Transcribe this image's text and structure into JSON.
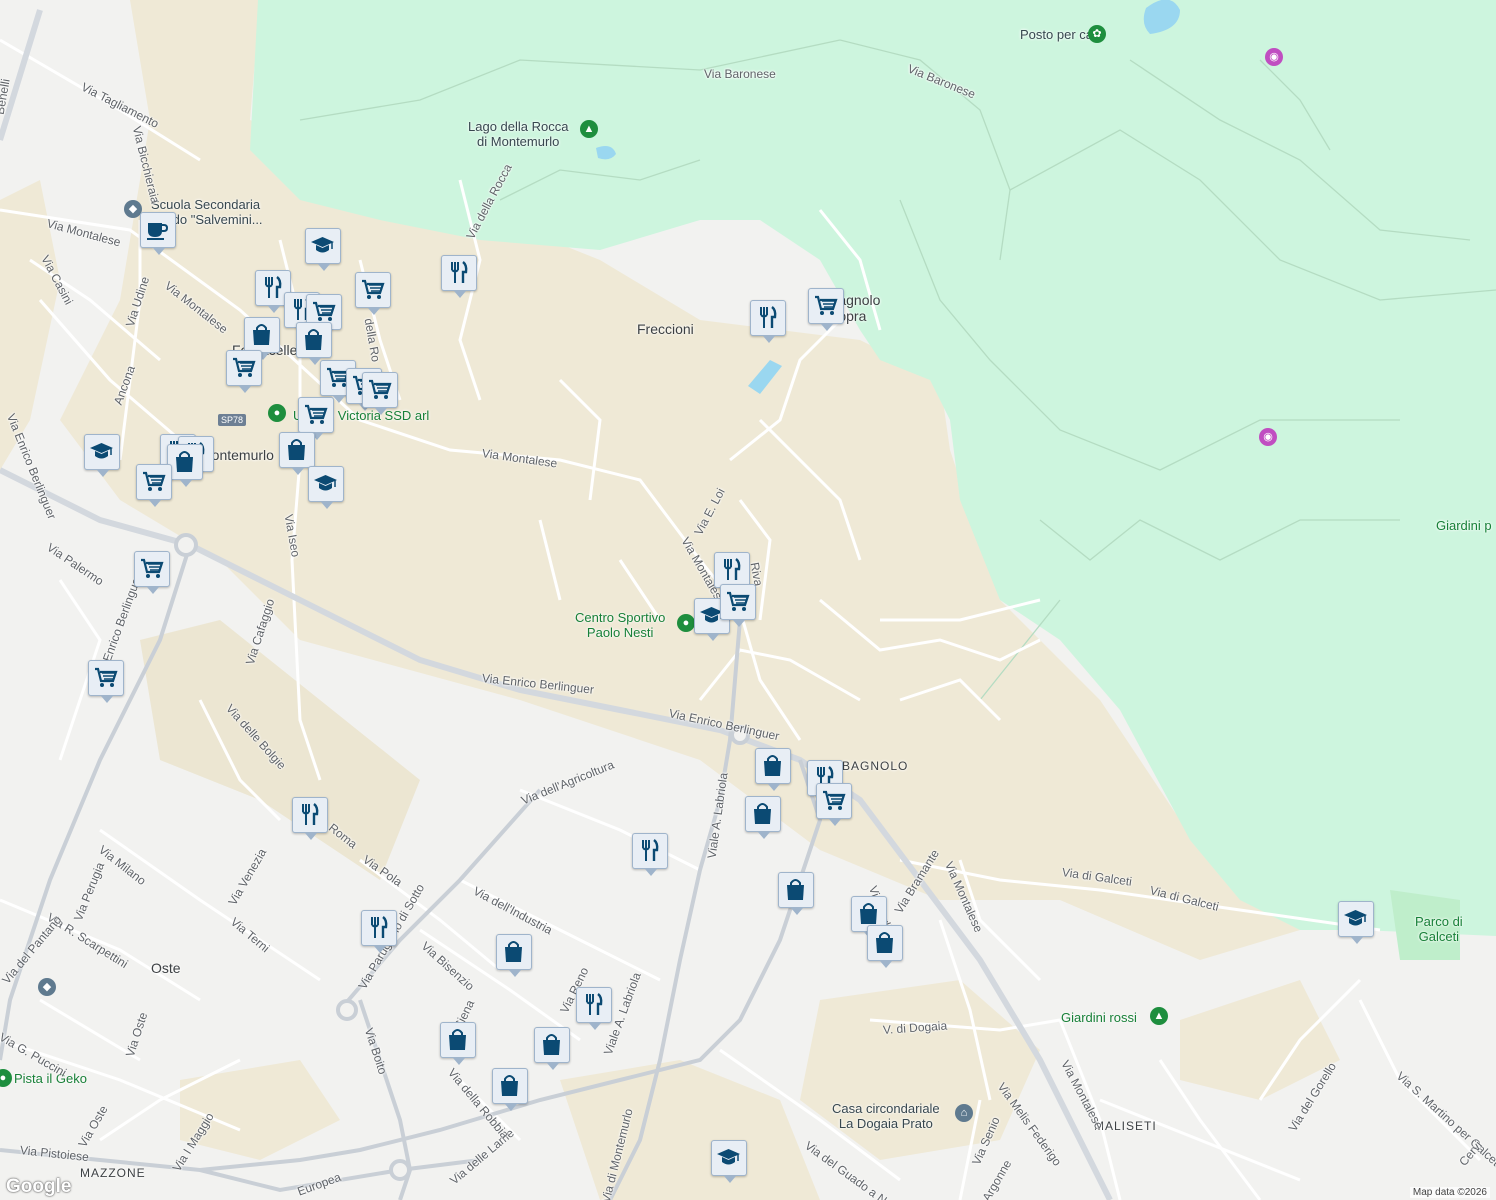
{
  "map": {
    "copyright": "Map data ©2026",
    "logo": "Google",
    "colors": {
      "background": "#f2f2f0",
      "park": "#cdf5de",
      "sand": "#efe9d6",
      "road": "#ffffff",
      "major_road": "#c9cfd6",
      "water": "#9ad7f0",
      "marker_bg": "#e8eef5",
      "marker_icon": "#0b4a73"
    },
    "places": {
      "montemurlo": "Montemurlo",
      "freccioni": "Freccioni",
      "bagnolo_sopra": "Bagnolo\nSopra",
      "oste": "Oste",
      "fornacelle": "Fornacelle"
    },
    "areas": {
      "bagnolo": "BAGNOLO",
      "maliseti": "MALISETI",
      "mazzone": "MAZZONE"
    },
    "pois": {
      "posto_per_cani": "Posto per cani",
      "lago": "Lago della Rocca\ndi Montemurlo",
      "scuola": "Scuola Secondaria\nGrado \"Salvemini...",
      "victoria": "Unione Victoria SSD arl",
      "centro_sportivo": "Centro Sportivo\nPaolo Nesti",
      "giardini_rossi": "Giardini rossi",
      "casa_circondariale": "Casa circondariale\nLa Dogaia Prato",
      "parco_galceti": "Parco di\nGalceti",
      "pista_geko": "Pista il Geko",
      "giardini_p": "Giardini p"
    },
    "roads": {
      "via_baronese_1": "Via Baronese",
      "via_baronese_2": "Via Baronese",
      "via_della_rocca": "Via della Rocca",
      "via_montalese_1": "Via Montalese",
      "via_montalese_2": "Via Montalese",
      "via_montalese_3": "Via Montalese",
      "via_montalese_4": "Via Montalese",
      "via_montalese_5": "Via Montalese",
      "via_montalese_6": "Via Montalese",
      "via_tagliamento": "Via Tagliamento",
      "via_bicchieraia": "Via Bicchieraia",
      "via_casini": "Via Casini",
      "via_udine": "Via Udine",
      "via_ancona": "Ancona",
      "via_berlinguer_1": "Via Enrico Berlinguer",
      "via_berlinguer_2": "Via Enrico Berlinguer",
      "via_berlinguer_3": "Via Enrico Berlinguer",
      "via_berlinguer_4": "Via Enrico Berlinguer",
      "via_palermo": "Via Palermo",
      "via_iseo": "Via Iseo",
      "via_cafaggio": "Via Cafaggio",
      "via_delle_bolgie": "Via delle Bolgie",
      "via_e_loi": "Via E. Loi",
      "via_dellagricoltura": "Via dell'Agricoltura",
      "viale_labriola": "Viale A. Labriola",
      "viale_labriola_2": "Viale A. Labriola",
      "via_dellindustria": "Via dell'Industria",
      "via_bisenzio": "Via Bisenzio",
      "via_parugiano": "Via Parugiano di Sotto",
      "via_pola": "Via Pola",
      "via_roma": "Roma",
      "via_milano": "Via Milano",
      "via_perugia": "Via Perugia",
      "via_venezia": "Via Venezia",
      "via_terni": "Via Terni",
      "via_scarpettini": "Via R. Scarpettini",
      "via_del_pantano": "Via del Pantano",
      "via_puccini": "Via G. Puccini",
      "via_oste_1": "Via Oste",
      "via_oste_2": "Via Oste",
      "via_boito": "Via Boito",
      "via_pistoiese": "Via Pistoiese",
      "via_i_maggio": "Via I Maggio",
      "via_europea": "Europea",
      "via_delle_lame": "Via delle Lame",
      "via_della_robbia": "Via della Robbia",
      "via_siena": "Siena",
      "via_reno": "Via Reno",
      "via_di_montemurlo": "Via di Montemurlo",
      "via_di_galceti_1": "Via di Galceti",
      "via_di_galceti_2": "Via di Galceti",
      "via_bramante": "Via Bramante",
      "v_di_dogaia": "V. di Dogaia",
      "via_melis_federigo": "Via Melis Federigo",
      "via_senio": "Via Senio",
      "via_argonne": "Argonne",
      "via_del_guado": "Via del Guado a Narnali",
      "via_del_gorello": "Via del Gorello",
      "via_s_martino": "Via S. Martino per Galceti",
      "via_cervi": "Cervi",
      "via_benelli": "Benelli",
      "via_riva": "Riva",
      "via_della_ro": "della Ro",
      "via_berlinguer_v": "Via Berlinguer"
    },
    "shield": "SP78",
    "markers": [
      {
        "type": "cafe-icon"
      },
      {
        "type": "school-icon"
      },
      {
        "type": "restaurant-icon"
      },
      {
        "type": "restaurant-icon"
      },
      {
        "type": "shopping-cart-icon"
      },
      {
        "type": "restaurant-icon"
      },
      {
        "type": "shopping-cart-icon"
      },
      {
        "type": "shopping-bag-icon"
      },
      {
        "type": "shopping-bag-icon"
      },
      {
        "type": "shopping-cart-icon"
      },
      {
        "type": "shopping-cart-icon"
      },
      {
        "type": "shopping-cart-icon"
      },
      {
        "type": "shopping-cart-icon"
      },
      {
        "type": "restaurant-icon"
      },
      {
        "type": "shopping-cart-icon"
      },
      {
        "type": "school-icon"
      },
      {
        "type": "restaurant-icon"
      },
      {
        "type": "shopping-bag-icon"
      },
      {
        "type": "shopping-cart-icon"
      },
      {
        "type": "shopping-bag-icon"
      },
      {
        "type": "school-icon"
      },
      {
        "type": "shopping-cart-icon"
      },
      {
        "type": "shopping-cart-icon"
      },
      {
        "type": "restaurant-icon"
      },
      {
        "type": "shopping-cart-icon"
      },
      {
        "type": "school-icon"
      },
      {
        "type": "shopping-bag-icon"
      },
      {
        "type": "restaurant-icon"
      },
      {
        "type": "shopping-cart-icon"
      },
      {
        "type": "restaurant-icon"
      },
      {
        "type": "shopping-bag-icon"
      },
      {
        "type": "shopping-cart-icon"
      },
      {
        "type": "restaurant-icon"
      },
      {
        "type": "shopping-bag-icon"
      },
      {
        "type": "shopping-bag-icon"
      },
      {
        "type": "shopping-bag-icon"
      },
      {
        "type": "restaurant-icon"
      },
      {
        "type": "shopping-bag-icon"
      },
      {
        "type": "restaurant-icon"
      },
      {
        "type": "shopping-bag-icon"
      },
      {
        "type": "shopping-bag-icon"
      },
      {
        "type": "shopping-bag-icon"
      },
      {
        "type": "school-icon"
      },
      {
        "type": "school-icon"
      },
      {
        "type": "restaurant-icon"
      }
    ]
  }
}
